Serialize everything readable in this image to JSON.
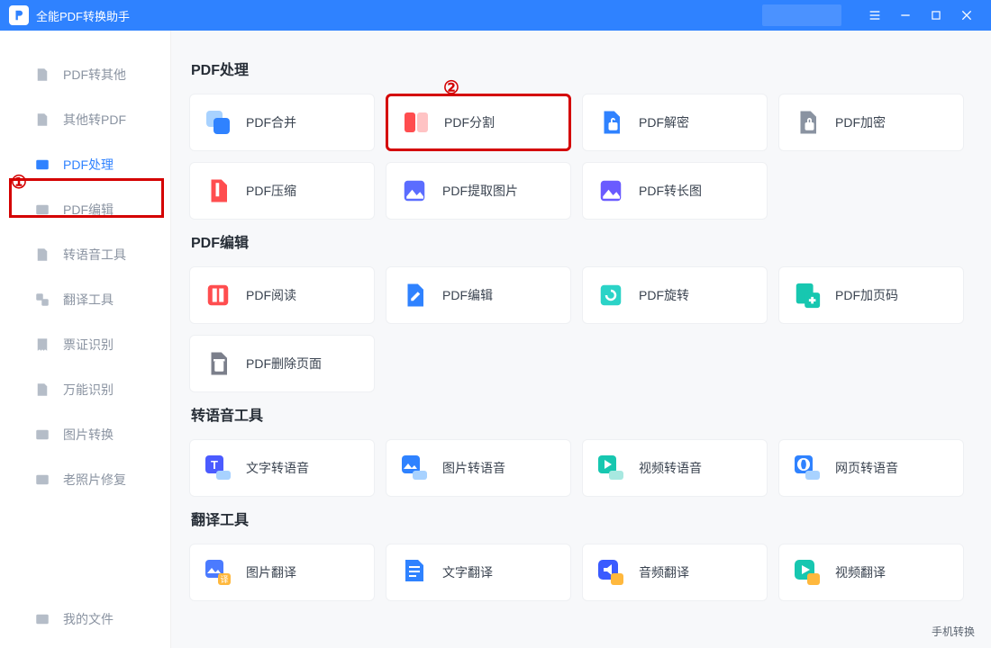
{
  "titlebar": {
    "title": "全能PDF转换助手"
  },
  "annotations": {
    "one": "①",
    "two": "②"
  },
  "sidebar": {
    "items": [
      {
        "label": "PDF转其他"
      },
      {
        "label": "其他转PDF"
      },
      {
        "label": "PDF处理"
      },
      {
        "label": "PDF编辑"
      },
      {
        "label": "转语音工具"
      },
      {
        "label": "翻译工具"
      },
      {
        "label": "票证识别"
      },
      {
        "label": "万能识别"
      },
      {
        "label": "图片转换"
      },
      {
        "label": "老照片修复"
      }
    ],
    "bottom": {
      "label": "我的文件"
    }
  },
  "sections": {
    "pdf_process": {
      "title": "PDF处理",
      "cards": [
        {
          "label": "PDF合并"
        },
        {
          "label": "PDF分割"
        },
        {
          "label": "PDF解密"
        },
        {
          "label": "PDF加密"
        },
        {
          "label": "PDF压缩"
        },
        {
          "label": "PDF提取图片"
        },
        {
          "label": "PDF转长图"
        }
      ]
    },
    "pdf_edit": {
      "title": "PDF编辑",
      "cards": [
        {
          "label": "PDF阅读"
        },
        {
          "label": "PDF编辑"
        },
        {
          "label": "PDF旋转"
        },
        {
          "label": "PDF加页码"
        },
        {
          "label": "PDF删除页面"
        }
      ]
    },
    "tts": {
      "title": "转语音工具",
      "cards": [
        {
          "label": "文字转语音"
        },
        {
          "label": "图片转语音"
        },
        {
          "label": "视频转语音"
        },
        {
          "label": "网页转语音"
        }
      ]
    },
    "translate": {
      "title": "翻译工具",
      "cards": [
        {
          "label": "图片翻译"
        },
        {
          "label": "文字翻译"
        },
        {
          "label": "音频翻译"
        },
        {
          "label": "视频翻译"
        }
      ]
    }
  },
  "footer": {
    "tag": "手机转换"
  }
}
